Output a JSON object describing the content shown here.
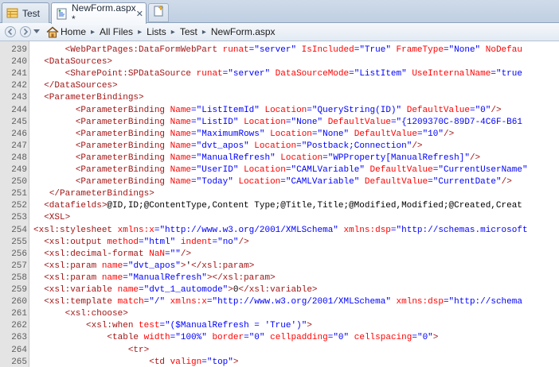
{
  "tabs": [
    {
      "label": "Test",
      "active": false,
      "icon": "list-icon"
    },
    {
      "label": "NewForm.aspx *",
      "active": true,
      "icon": "aspx-page-icon",
      "close": "✕"
    }
  ],
  "breadcrumb": [
    "Home",
    "All Files",
    "Lists",
    "Test",
    "NewForm.aspx"
  ],
  "code_lines": [
    {
      "n": "239",
      "indent": "      ",
      "parts": [
        [
          "tag",
          "<WebPartPages:DataFormWebPart"
        ],
        [
          "attr",
          " runat"
        ],
        [
          "punc",
          "="
        ],
        [
          "val",
          "\"server\""
        ],
        [
          "attr",
          " IsIncluded"
        ],
        [
          "punc",
          "="
        ],
        [
          "val",
          "\"True\""
        ],
        [
          "attr",
          " FrameType"
        ],
        [
          "punc",
          "="
        ],
        [
          "val",
          "\"None\""
        ],
        [
          "attr",
          " NoDefau"
        ]
      ]
    },
    {
      "n": "240",
      "indent": "  ",
      "parts": [
        [
          "tag",
          "<DataSources>"
        ]
      ]
    },
    {
      "n": "241",
      "indent": "      ",
      "parts": [
        [
          "tag",
          "<SharePoint:SPDataSource"
        ],
        [
          "attr",
          " runat"
        ],
        [
          "punc",
          "="
        ],
        [
          "val",
          "\"server\""
        ],
        [
          "attr",
          " DataSourceMode"
        ],
        [
          "punc",
          "="
        ],
        [
          "val",
          "\"ListItem\""
        ],
        [
          "attr",
          " UseInternalName"
        ],
        [
          "punc",
          "="
        ],
        [
          "val",
          "\"true"
        ]
      ]
    },
    {
      "n": "242",
      "indent": "  ",
      "parts": [
        [
          "tag",
          "</DataSources>"
        ]
      ]
    },
    {
      "n": "243",
      "indent": "  ",
      "parts": [
        [
          "tag",
          "<ParameterBindings>"
        ]
      ]
    },
    {
      "n": "244",
      "indent": "        ",
      "parts": [
        [
          "tag",
          "<ParameterBinding"
        ],
        [
          "attr",
          " Name"
        ],
        [
          "punc",
          "="
        ],
        [
          "val",
          "\"ListItemId\""
        ],
        [
          "attr",
          " Location"
        ],
        [
          "punc",
          "="
        ],
        [
          "val",
          "\"QueryString(ID)\""
        ],
        [
          "attr",
          " DefaultValue"
        ],
        [
          "punc",
          "="
        ],
        [
          "val",
          "\"0\""
        ],
        [
          "tag",
          "/>"
        ]
      ]
    },
    {
      "n": "245",
      "indent": "        ",
      "parts": [
        [
          "tag",
          "<ParameterBinding"
        ],
        [
          "attr",
          " Name"
        ],
        [
          "punc",
          "="
        ],
        [
          "val",
          "\"ListID\""
        ],
        [
          "attr",
          " Location"
        ],
        [
          "punc",
          "="
        ],
        [
          "val",
          "\"None\""
        ],
        [
          "attr",
          " DefaultValue"
        ],
        [
          "punc",
          "="
        ],
        [
          "val",
          "\"{1209370C-89D7-4C6F-B61"
        ]
      ]
    },
    {
      "n": "246",
      "indent": "        ",
      "parts": [
        [
          "tag",
          "<ParameterBinding"
        ],
        [
          "attr",
          " Name"
        ],
        [
          "punc",
          "="
        ],
        [
          "val",
          "\"MaximumRows\""
        ],
        [
          "attr",
          " Location"
        ],
        [
          "punc",
          "="
        ],
        [
          "val",
          "\"None\""
        ],
        [
          "attr",
          " DefaultValue"
        ],
        [
          "punc",
          "="
        ],
        [
          "val",
          "\"10\""
        ],
        [
          "tag",
          "/>"
        ]
      ]
    },
    {
      "n": "247",
      "indent": "        ",
      "parts": [
        [
          "tag",
          "<ParameterBinding"
        ],
        [
          "attr",
          " Name"
        ],
        [
          "punc",
          "="
        ],
        [
          "val",
          "\"dvt_apos\""
        ],
        [
          "attr",
          " Location"
        ],
        [
          "punc",
          "="
        ],
        [
          "val",
          "\"Postback;Connection\""
        ],
        [
          "tag",
          "/>"
        ]
      ]
    },
    {
      "n": "248",
      "indent": "        ",
      "parts": [
        [
          "tag",
          "<ParameterBinding"
        ],
        [
          "attr",
          " Name"
        ],
        [
          "punc",
          "="
        ],
        [
          "val",
          "\"ManualRefresh\""
        ],
        [
          "attr",
          " Location"
        ],
        [
          "punc",
          "="
        ],
        [
          "val",
          "\"WPProperty[ManualRefresh]\""
        ],
        [
          "tag",
          "/>"
        ]
      ]
    },
    {
      "n": "249",
      "indent": "        ",
      "parts": [
        [
          "tag",
          "<ParameterBinding"
        ],
        [
          "attr",
          " Name"
        ],
        [
          "punc",
          "="
        ],
        [
          "val",
          "\"UserID\""
        ],
        [
          "attr",
          " Location"
        ],
        [
          "punc",
          "="
        ],
        [
          "val",
          "\"CAMLVariable\""
        ],
        [
          "attr",
          " DefaultValue"
        ],
        [
          "punc",
          "="
        ],
        [
          "val",
          "\"CurrentUserName\""
        ]
      ]
    },
    {
      "n": "250",
      "indent": "        ",
      "parts": [
        [
          "tag",
          "<ParameterBinding"
        ],
        [
          "attr",
          " Name"
        ],
        [
          "punc",
          "="
        ],
        [
          "val",
          "\"Today\""
        ],
        [
          "attr",
          " Location"
        ],
        [
          "punc",
          "="
        ],
        [
          "val",
          "\"CAMLVariable\""
        ],
        [
          "attr",
          " DefaultValue"
        ],
        [
          "punc",
          "="
        ],
        [
          "val",
          "\"CurrentDate\""
        ],
        [
          "tag",
          "/>"
        ]
      ]
    },
    {
      "n": "251",
      "indent": "   ",
      "parts": [
        [
          "tag",
          "</ParameterBindings>"
        ]
      ]
    },
    {
      "n": "252",
      "indent": "  ",
      "parts": [
        [
          "tag",
          "<datafields>"
        ],
        [
          "txt",
          "@ID,ID;@ContentType,Content Type;@Title,Title;@Modified,Modified;@Created,Creat"
        ]
      ]
    },
    {
      "n": "253",
      "indent": "  ",
      "parts": [
        [
          "tag",
          "<XSL>"
        ]
      ]
    },
    {
      "n": "254",
      "indent": "",
      "parts": [
        [
          "tag",
          "<xsl:stylesheet"
        ],
        [
          "attr",
          " xmlns:x"
        ],
        [
          "punc",
          "="
        ],
        [
          "val",
          "\"http://www.w3.org/2001/XMLSchema\""
        ],
        [
          "attr",
          " xmlns:dsp"
        ],
        [
          "punc",
          "="
        ],
        [
          "val",
          "\"http://schemas.microsoft"
        ]
      ]
    },
    {
      "n": "255",
      "indent": "  ",
      "parts": [
        [
          "tag",
          "<xsl:output"
        ],
        [
          "attr",
          " method"
        ],
        [
          "punc",
          "="
        ],
        [
          "val",
          "\"html\""
        ],
        [
          "attr",
          " indent"
        ],
        [
          "punc",
          "="
        ],
        [
          "val",
          "\"no\""
        ],
        [
          "tag",
          "/>"
        ]
      ]
    },
    {
      "n": "256",
      "indent": "  ",
      "parts": [
        [
          "tag",
          "<xsl:decimal-format"
        ],
        [
          "attr",
          " NaN"
        ],
        [
          "punc",
          "="
        ],
        [
          "val",
          "\"\""
        ],
        [
          "tag",
          "/>"
        ]
      ]
    },
    {
      "n": "257",
      "indent": "  ",
      "parts": [
        [
          "tag",
          "<xsl:param"
        ],
        [
          "attr",
          " name"
        ],
        [
          "punc",
          "="
        ],
        [
          "val",
          "\"dvt_apos\""
        ],
        [
          "tag",
          ">"
        ],
        [
          "txt",
          "'"
        ],
        [
          "tag",
          "</xsl:param>"
        ]
      ]
    },
    {
      "n": "258",
      "indent": "  ",
      "parts": [
        [
          "tag",
          "<xsl:param"
        ],
        [
          "attr",
          " name"
        ],
        [
          "punc",
          "="
        ],
        [
          "val",
          "\"ManualRefresh\""
        ],
        [
          "tag",
          "></xsl:param>"
        ]
      ]
    },
    {
      "n": "259",
      "indent": "  ",
      "parts": [
        [
          "tag",
          "<xsl:variable"
        ],
        [
          "attr",
          " name"
        ],
        [
          "punc",
          "="
        ],
        [
          "val",
          "\"dvt_1_automode\""
        ],
        [
          "tag",
          ">"
        ],
        [
          "txt",
          "0"
        ],
        [
          "tag",
          "</xsl:variable>"
        ]
      ]
    },
    {
      "n": "260",
      "indent": "  ",
      "parts": [
        [
          "tag",
          "<xsl:template"
        ],
        [
          "attr",
          " match"
        ],
        [
          "punc",
          "="
        ],
        [
          "val",
          "\"/\""
        ],
        [
          "attr",
          " xmlns:x"
        ],
        [
          "punc",
          "="
        ],
        [
          "val",
          "\"http://www.w3.org/2001/XMLSchema\""
        ],
        [
          "attr",
          " xmlns:dsp"
        ],
        [
          "punc",
          "="
        ],
        [
          "val",
          "\"http://schema"
        ]
      ]
    },
    {
      "n": "261",
      "indent": "      ",
      "parts": [
        [
          "tag",
          "<xsl:choose>"
        ]
      ]
    },
    {
      "n": "262",
      "indent": "          ",
      "parts": [
        [
          "tag",
          "<xsl:when"
        ],
        [
          "attr",
          " test"
        ],
        [
          "punc",
          "="
        ],
        [
          "val",
          "\"($ManualRefresh = 'True')\""
        ],
        [
          "tag",
          ">"
        ]
      ]
    },
    {
      "n": "263",
      "indent": "              ",
      "parts": [
        [
          "tag",
          "<table"
        ],
        [
          "attr",
          " width"
        ],
        [
          "punc",
          "="
        ],
        [
          "val",
          "\"100%\""
        ],
        [
          "attr",
          " border"
        ],
        [
          "punc",
          "="
        ],
        [
          "val",
          "\"0\""
        ],
        [
          "attr",
          " cellpadding"
        ],
        [
          "punc",
          "="
        ],
        [
          "val",
          "\"0\""
        ],
        [
          "attr",
          " cellspacing"
        ],
        [
          "punc",
          "="
        ],
        [
          "val",
          "\"0\""
        ],
        [
          "tag",
          ">"
        ]
      ]
    },
    {
      "n": "264",
      "indent": "                  ",
      "parts": [
        [
          "tag",
          "<tr>"
        ]
      ]
    },
    {
      "n": "265",
      "indent": "                      ",
      "parts": [
        [
          "tag",
          "<td"
        ],
        [
          "attr",
          " valign"
        ],
        [
          "punc",
          "="
        ],
        [
          "val",
          "\"top\""
        ],
        [
          "tag",
          ">"
        ]
      ]
    }
  ]
}
